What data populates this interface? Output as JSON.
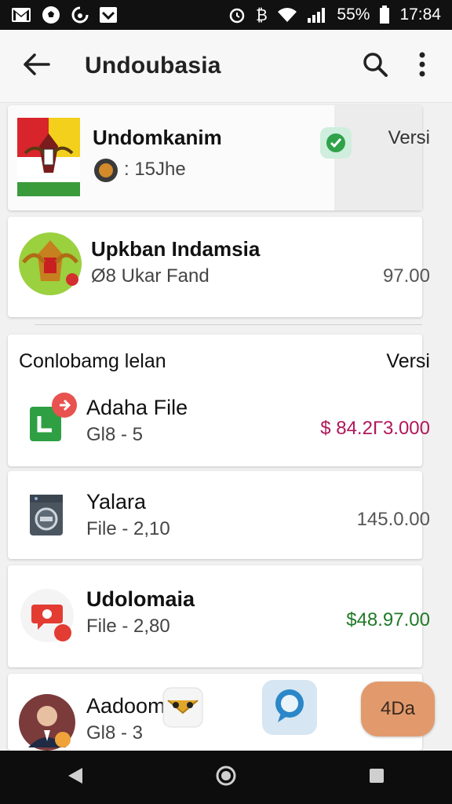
{
  "status_bar": {
    "battery": "55%",
    "time": "17:84",
    "left_icons": [
      "gmail-icon",
      "soccer-ball-icon",
      "sync-icon",
      "image-icon"
    ],
    "right_icons": [
      "alarm-icon",
      "bitcoin-icon",
      "wifi-icon",
      "signal-icon",
      "battery-icon"
    ]
  },
  "app_bar": {
    "title": "Undoubasia",
    "back_icon": "arrow-left-icon",
    "search_icon": "search-icon",
    "more_icon": "more-vert-icon"
  },
  "top_cards": [
    {
      "title": "Undomkanim",
      "subtitle": ": 15Jhe",
      "badge_icon": "check-badge-icon",
      "right_label": "Versi",
      "thumb_icon": "indonesia-emblem-flag-icon",
      "sub_icon": "coin-icon"
    },
    {
      "title": "Upkban Indamsia",
      "subtitle": "Ø8 Ukar Fand",
      "value": "97.00",
      "thumb_icon": "garuda-emblem-icon"
    }
  ],
  "section": {
    "header": "Conlobamg lelan",
    "right_label": "Versi"
  },
  "list": [
    {
      "title": "Adaha File",
      "subtitle": "Gl8 - 5",
      "value": "$ 84.2Г3.000",
      "value_color": "#b0175a",
      "icon": "file-download-icon"
    },
    {
      "title": "Yalara",
      "subtitle": "File - 2,10",
      "value": "145.0.00",
      "value_color": "#555555",
      "icon": "washing-machine-icon"
    },
    {
      "title": "Udolomaia",
      "subtitle": "File - 2,80",
      "value": "$48.97.00",
      "value_color": "#1f7a25",
      "icon": "chat-bubble-icon"
    },
    {
      "title": "Aadoom",
      "subtitle": "Gl8 - 3",
      "icon": "avatar-photo-icon"
    }
  ],
  "floating": {
    "mail_icon": "owl-mail-icon",
    "chat_icon": "blue-chat-icon",
    "pill_label": "4Da"
  },
  "nav_bar": {
    "back_icon": "nav-back-icon",
    "home_icon": "nav-home-icon",
    "recents_icon": "nav-recents-icon"
  }
}
